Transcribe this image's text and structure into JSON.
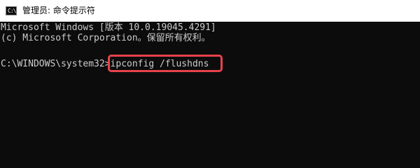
{
  "window": {
    "title": "管理员: 命令提示符",
    "icon": "cmd-icon",
    "icon_glyph": "C:\\"
  },
  "console": {
    "lines": [
      "Microsoft Windows [版本 10.0.19045.4291]",
      "(c) Microsoft Corporation。保留所有权利。"
    ],
    "prompt": "C:\\WINDOWS\\system32>",
    "command": "ipconfig /flushdns",
    "highlight_color": "#e8424b",
    "background_color": "#0c0c0c",
    "text_color": "#cccccc"
  }
}
